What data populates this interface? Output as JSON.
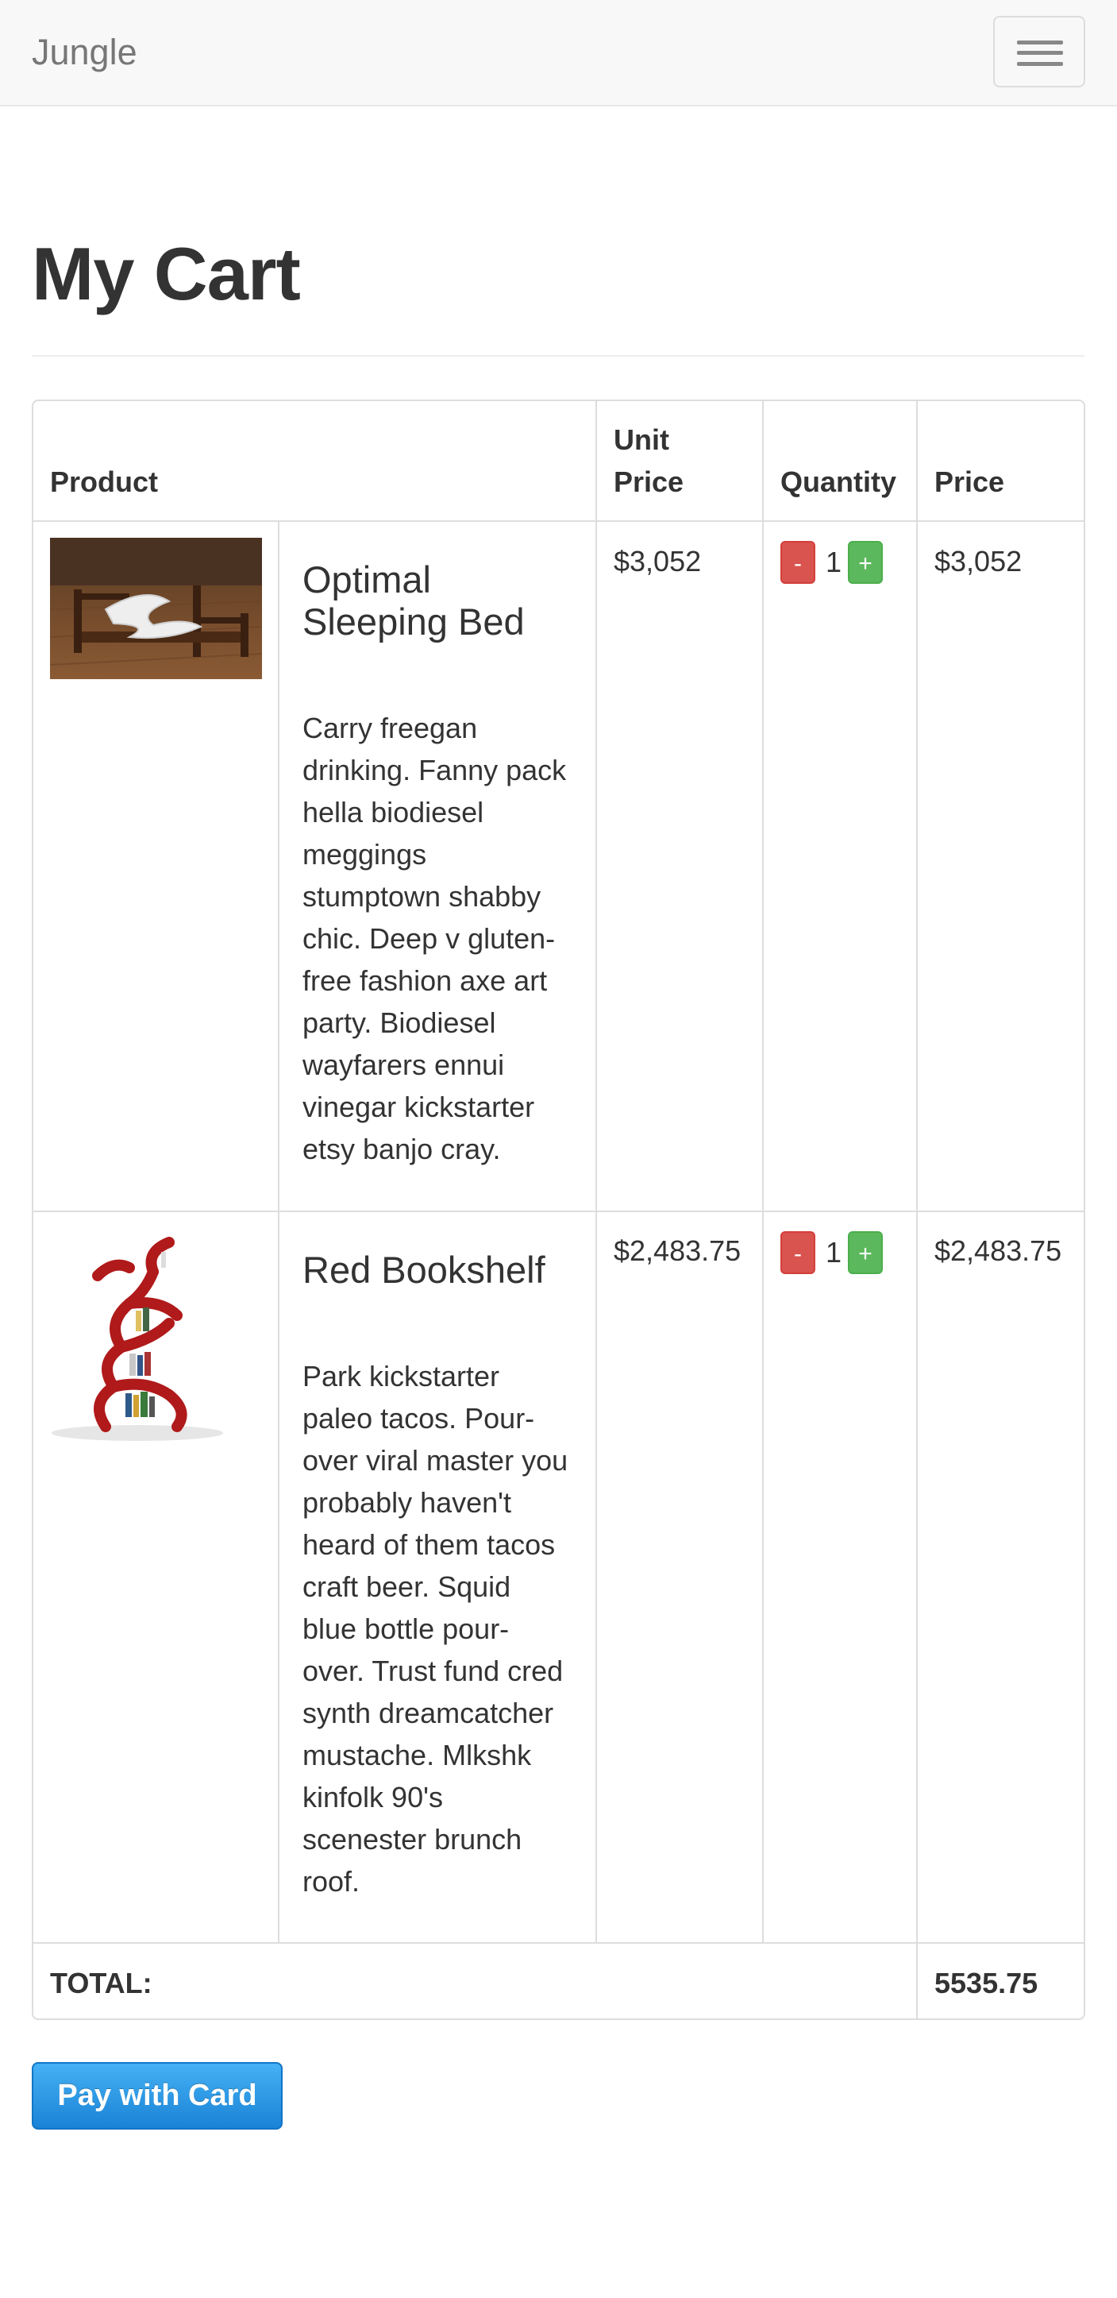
{
  "navbar": {
    "brand": "Jungle",
    "toggle_icon": "hamburger-menu-icon"
  },
  "page": {
    "title": "My Cart"
  },
  "table": {
    "headers": {
      "product": "Product",
      "unit_price_line1": "Unit",
      "unit_price_line2": "Price",
      "quantity": "Quantity",
      "price": "Price"
    },
    "rows": [
      {
        "name_line1": "Optimal",
        "name_line2": "Sleeping Bed",
        "description_lines": [
          "Carry freegan",
          "drinking. Fanny pack",
          "hella biodiesel",
          "meggings",
          "stumptown shabby",
          "chic. Deep v gluten-",
          "free fashion axe art",
          "party. Biodiesel",
          "wayfarers ennui",
          "vinegar kickstarter",
          "etsy banjo cray."
        ],
        "image_icon": "bed-product-image",
        "unit_price": "$3,052",
        "minus_label": "-",
        "quantity": "1",
        "plus_label": "+",
        "price": "$3,052"
      },
      {
        "name_line1": "Red Bookshelf",
        "description_lines": [
          "Park kickstarter",
          "paleo tacos. Pour-",
          "over viral master you",
          "probably haven't",
          "heard of them tacos",
          "craft beer. Squid",
          "blue bottle pour-",
          "over. Trust fund cred",
          "synth dreamcatcher",
          "mustache. Mlkshk",
          "kinfolk 90's",
          "scenester brunch",
          "roof."
        ],
        "image_icon": "bookshelf-product-image",
        "unit_price": "$2,483.75",
        "minus_label": "-",
        "quantity": "1",
        "plus_label": "+",
        "price": "$2,483.75"
      }
    ],
    "total_label": "TOTAL:",
    "total_value": "5535.75"
  },
  "checkout": {
    "pay_label": "Pay with Card"
  },
  "colors": {
    "navbar_bg": "#f8f8f8",
    "minus_button": "#d9534f",
    "plus_button": "#5cb85c",
    "pay_button": "#1a83d6"
  }
}
